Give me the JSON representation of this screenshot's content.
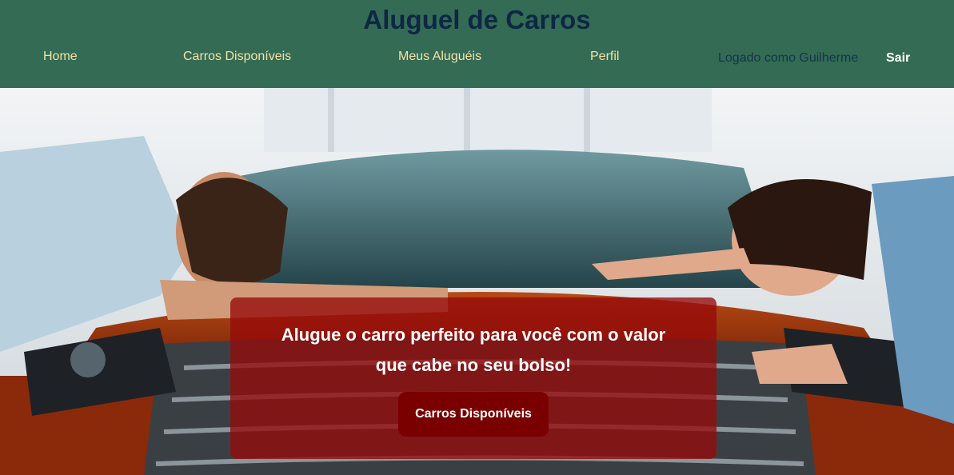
{
  "header": {
    "title": "Aluguel de Carros",
    "nav": [
      {
        "label": "Home"
      },
      {
        "label": "Carros Disponíveis"
      },
      {
        "label": "Meus Aluguéis"
      },
      {
        "label": "Perfil"
      }
    ],
    "logged_in_text": "Logado como Guilherme",
    "logout_label": "Sair"
  },
  "hero": {
    "image_description_icon": "car-hero-photo",
    "promo_line1": "Alugue o carro perfeito para você com o valor",
    "promo_line2": "que cabe no seu bolso!",
    "cta_label": "Carros Disponíveis"
  },
  "colors": {
    "header_bg": "#346b54",
    "title": "#0e2744",
    "nav_text": "#f4e1a6",
    "promo_bg": "#960a0a",
    "cta_bg": "#7a0000"
  }
}
